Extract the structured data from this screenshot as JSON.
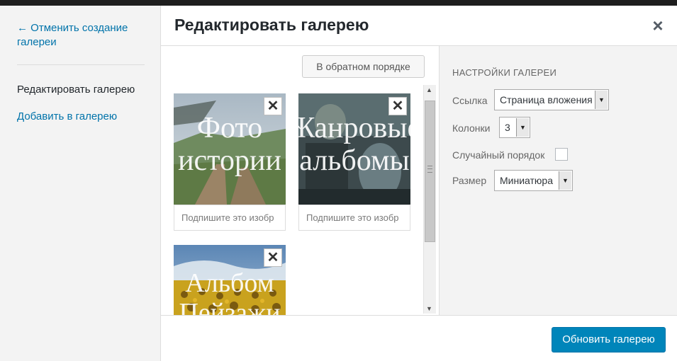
{
  "sidebar": {
    "cancel_link": "← Отменить создание галереи",
    "items": [
      {
        "label": "Редактировать галерею",
        "active": true
      },
      {
        "label": "Добавить в галерею",
        "active": false
      }
    ]
  },
  "header": {
    "title": "Редактировать галерею",
    "close_icon": "close-icon"
  },
  "toolbar": {
    "reverse_label": "В обратном порядке"
  },
  "gallery": {
    "items": [
      {
        "overlay_line1": "Фото",
        "overlay_line2": "истории",
        "caption_placeholder": "Подпишите это изобр"
      },
      {
        "overlay_line1": "Жанровые",
        "overlay_line2": "альбомы",
        "caption_placeholder": "Подпишите это изобр"
      },
      {
        "overlay_line1": "Альбом",
        "overlay_line2": "Пейзажи",
        "caption_placeholder": ""
      }
    ]
  },
  "settings": {
    "heading": "НАСТРОЙКИ ГАЛЕРЕИ",
    "link": {
      "label": "Ссылка",
      "value": "Страница вложения"
    },
    "columns": {
      "label": "Колонки",
      "value": "3"
    },
    "random": {
      "label": "Случайный порядок",
      "checked": false
    },
    "size": {
      "label": "Размер",
      "value": "Миниатюра"
    }
  },
  "footer": {
    "update_label": "Обновить галерею"
  },
  "colors": {
    "accent": "#0085ba",
    "link": "#0073aa"
  }
}
